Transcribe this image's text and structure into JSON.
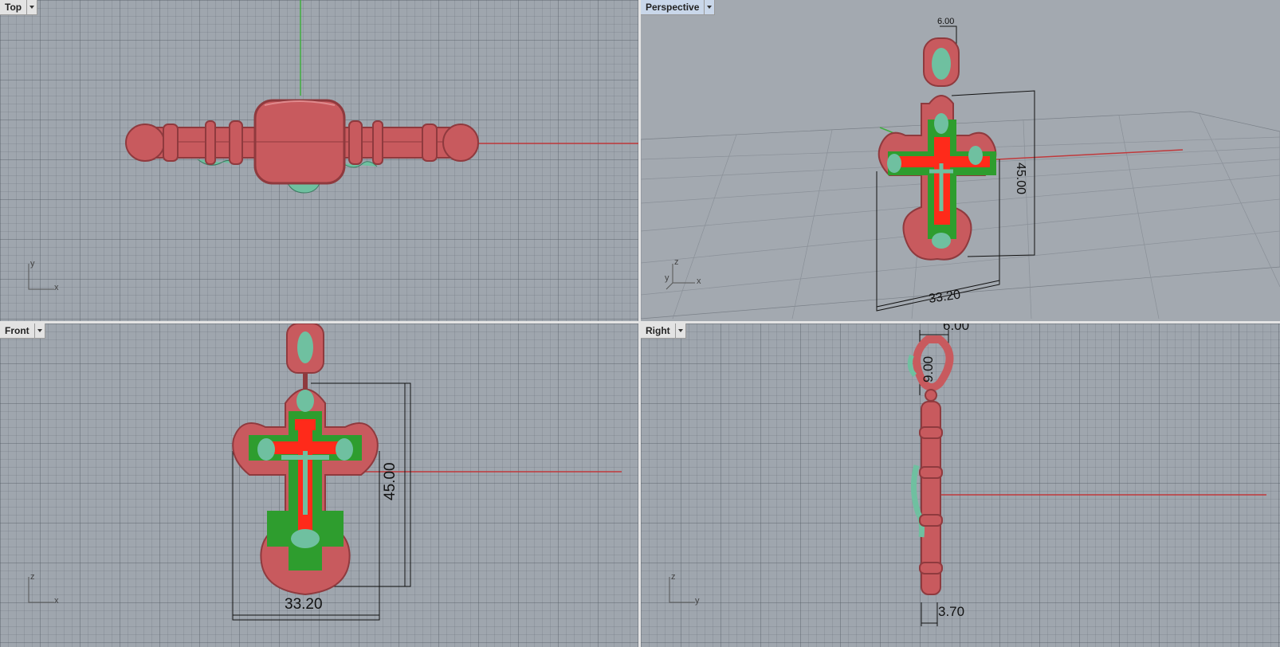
{
  "viewports": {
    "top": {
      "label": "Top",
      "axis_a": "y",
      "axis_b": "x"
    },
    "perspective": {
      "label": "Perspective",
      "axis_a": "z",
      "axis_b": "x",
      "axis_c": "y",
      "dim_top": "6.00",
      "dim_height": "45.00",
      "dim_width": "33.20"
    },
    "front": {
      "label": "Front",
      "axis_a": "z",
      "axis_b": "x",
      "dim_height": "45.00",
      "dim_width": "33.20"
    },
    "right": {
      "label": "Right",
      "axis_a": "z",
      "axis_b": "y",
      "dim_top": "6.00",
      "dim_loop": "9.00",
      "dim_bottom": "3.70"
    }
  },
  "colors": {
    "model": "#c85a5e",
    "model_dark": "#8f3a3e",
    "relief": "#6fc0a0",
    "fill": "#2e9d2e",
    "accent": "#ff2a1a"
  }
}
